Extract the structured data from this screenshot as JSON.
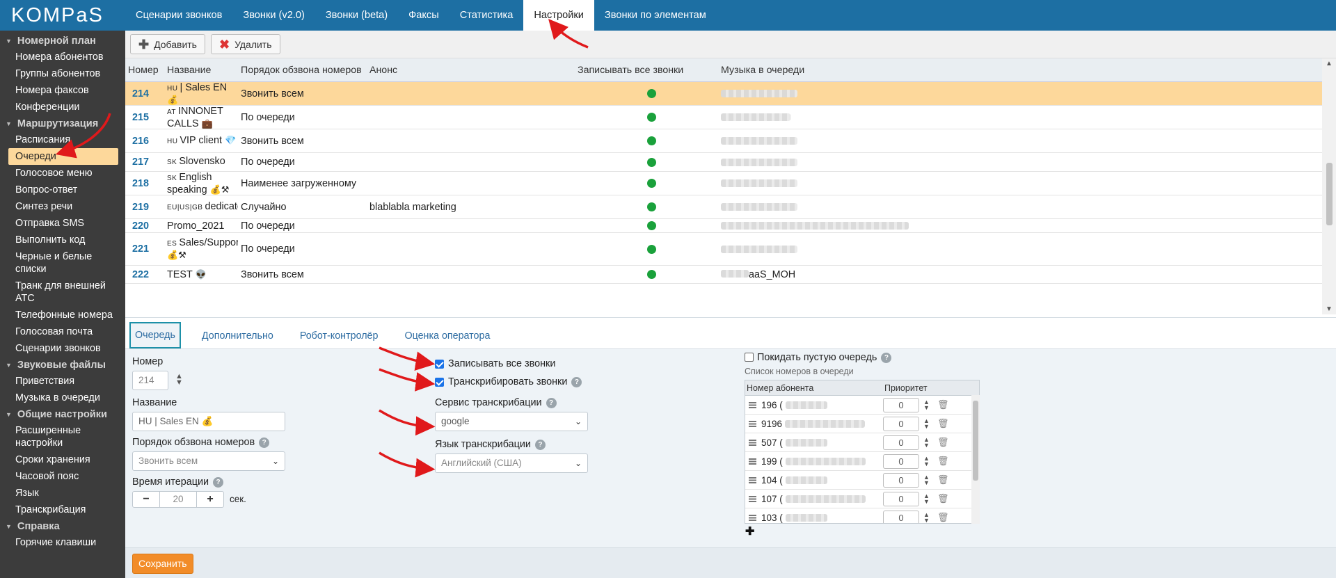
{
  "app": {
    "logo": "KOMPaS"
  },
  "topnav": [
    "Сценарии звонков",
    "Звонки (v2.0)",
    "Звонки (beta)",
    "Факсы",
    "Статистика",
    "Настройки",
    "Звонки по элементам"
  ],
  "active_topnav": "Настройки",
  "sidebar": {
    "sections": [
      {
        "title": "Номерной план",
        "items": [
          "Номера абонентов",
          "Группы абонентов",
          "Номера факсов",
          "Конференции"
        ]
      },
      {
        "title": "Маршрутизация",
        "items": [
          "Расписания",
          "Очереди",
          "Голосовое меню",
          "Вопрос-ответ",
          "Синтез речи",
          "Отправка SMS",
          "Выполнить код",
          "Черные и белые списки",
          "Транк для внешней АТС",
          "Телефонные номера",
          "Голосовая почта",
          "Сценарии звонков"
        ]
      },
      {
        "title": "Звуковые файлы",
        "items": [
          "Приветствия",
          "Музыка в очереди"
        ]
      },
      {
        "title": "Общие настройки",
        "items": [
          "Расширенные настройки",
          "Сроки хранения",
          "Часовой пояс",
          "Язык",
          "Транскрибация"
        ]
      },
      {
        "title": "Справка",
        "items": [
          "Горячие клавиши"
        ]
      }
    ],
    "active_item": "Очереди"
  },
  "toolbar": {
    "add_label": "Добавить",
    "delete_label": "Удалить"
  },
  "table": {
    "headers": [
      "Номер",
      "Название",
      "Порядок обзвона номеров",
      "Анонс",
      "Записывать все звонки",
      "Музыка в очереди"
    ],
    "rows": [
      {
        "num": "214",
        "lang": "HU",
        "name": "| Sales EN",
        "emoji": "💰",
        "order": "Звонить всем",
        "announce": "",
        "music_visible": "",
        "selected": true
      },
      {
        "num": "215",
        "lang": "AT",
        "name": "INNONET CALLS",
        "emoji": "💼",
        "order": "По очереди",
        "announce": "",
        "music_visible": ""
      },
      {
        "num": "216",
        "lang": "HU",
        "name": "VIP client",
        "emoji": "💎",
        "order": "Звонить всем",
        "announce": "",
        "music_visible": ""
      },
      {
        "num": "217",
        "lang": "SK",
        "name": "Slovensko",
        "emoji": "",
        "order": "По очереди",
        "announce": "",
        "music_visible": ""
      },
      {
        "num": "218",
        "lang": "SK",
        "name": "English speaking",
        "emoji": "💰⚒",
        "order": "Наименее загруженному",
        "announce": "",
        "music_visible": ""
      },
      {
        "num": "219",
        "lang": "EU|US|GB",
        "name": "dedicated",
        "emoji": "",
        "order": "Случайно",
        "announce": "blablabla marketing",
        "music_visible": ""
      },
      {
        "num": "220",
        "lang": "",
        "name": "Promo_2021",
        "emoji": "",
        "order": "По очереди",
        "announce": "",
        "music_visible": ""
      },
      {
        "num": "221",
        "lang": "ES",
        "name": "Sales/Support",
        "emoji": "💰⚒",
        "order": "По очереди",
        "announce": "",
        "music_visible": ""
      },
      {
        "num": "222",
        "lang": "",
        "name": "TEST",
        "emoji": "👽",
        "order": "Звонить всем",
        "announce": "",
        "music_visible": "aaS_MOH"
      }
    ]
  },
  "detail": {
    "tabs": [
      "Очередь",
      "Дополнительно",
      "Робот-контролёр",
      "Оценка оператора"
    ],
    "active_tab": "Очередь",
    "number_label": "Номер",
    "number_value": "214",
    "name_label": "Название",
    "name_value": "HU | Sales EN 💰",
    "order_label": "Порядок обзвона номеров",
    "order_value": "Звонить всем",
    "iteration_label": "Время итерации",
    "iteration_value": "20",
    "iteration_unit": "сек.",
    "record_all_label": "Записывать все звонки",
    "record_all_checked": true,
    "transcribe_label": "Транскрибировать звонки",
    "transcribe_checked": true,
    "service_label": "Сервис транскрибации",
    "service_value": "google",
    "language_label": "Язык транскрибации",
    "language_value": "Английский (США)",
    "leave_empty_label": "Покидать пустую очередь",
    "leave_empty_checked": false,
    "members_title": "Список номеров в очереди",
    "members_headers": [
      "Номер абонента",
      "Приоритет"
    ],
    "members": [
      {
        "prefix": "196 (",
        "priority": "0"
      },
      {
        "prefix": "9196",
        "priority": "0"
      },
      {
        "prefix": "507 (",
        "priority": "0"
      },
      {
        "prefix": "199 (",
        "priority": "0"
      },
      {
        "prefix": "104 (",
        "priority": "0"
      },
      {
        "prefix": "107 (",
        "priority": "0"
      },
      {
        "prefix": "103 (",
        "priority": "0"
      }
    ]
  },
  "save_label": "Сохранить",
  "colors": {
    "topbar": "#1d6fa3",
    "sidebar": "#3c3c3c",
    "selected_row": "#fdd89b",
    "save": "#f28c28",
    "status_dot": "#1aa13b",
    "arrow": "#e0191b"
  }
}
